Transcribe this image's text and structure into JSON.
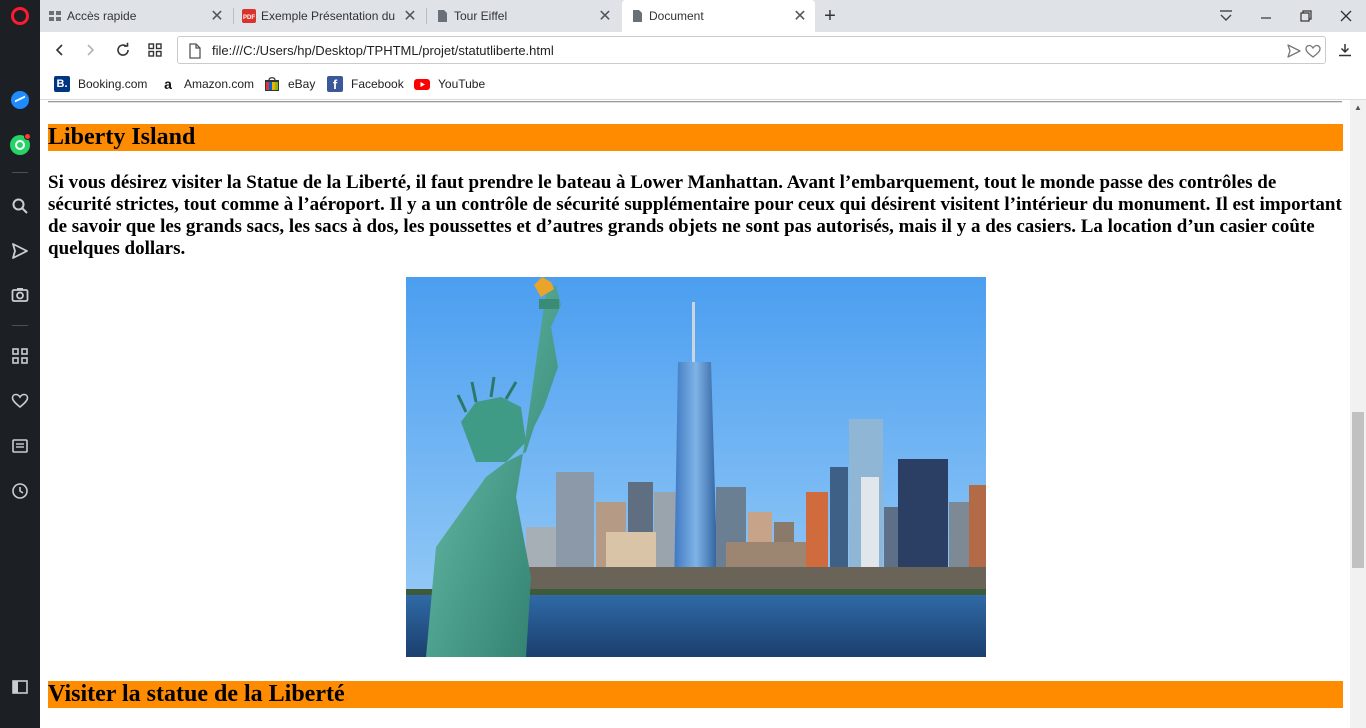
{
  "tabs": [
    {
      "title": "Accès rapide",
      "icon": "speed-dial-icon"
    },
    {
      "title": "Exemple Présentation du p",
      "icon": "pdf-icon"
    },
    {
      "title": "Tour Eiffel",
      "icon": "document-icon"
    },
    {
      "title": "Document",
      "icon": "document-icon",
      "active": true
    }
  ],
  "address": {
    "url": "file:///C:/Users/hp/Desktop/TPHTML/projet/statutliberte.html"
  },
  "bookmarks": [
    {
      "label": "Booking.com",
      "icon_letter": "B.",
      "color": "#003580"
    },
    {
      "label": "Amazon.com",
      "icon_letter": "a",
      "color": "#ffffff"
    },
    {
      "label": "eBay",
      "icon_letter": "",
      "color": "#e53238"
    },
    {
      "label": "Facebook",
      "icon_letter": "f",
      "color": "#3b5998"
    },
    {
      "label": "YouTube",
      "icon_letter": "",
      "color": "#ff0000"
    }
  ],
  "page": {
    "heading1": "Liberty Island",
    "paragraph": "Si vous désirez visiter la Statue de la Liberté, il faut prendre le bateau à Lower Manhattan. Avant l’embarquement, tout le monde passe des contrôles de sécurité strictes, tout comme à l’aéroport. Il y a un contrôle de sécurité supplémentaire pour ceux qui désirent visitent l’intérieur du monument. Il est important de savoir que les grands sacs, les sacs à dos, les poussettes et d’autres grands objets ne sont pas autorisés, mais il y a des casiers. La location d’un casier coûte quelques dollars.",
    "heading2": "Visiter la statue de la Liberté"
  },
  "colors": {
    "heading_bg": "#ff8c00",
    "sidebar_bg": "#1c2024",
    "tabstrip_bg": "#dfe3e8"
  }
}
